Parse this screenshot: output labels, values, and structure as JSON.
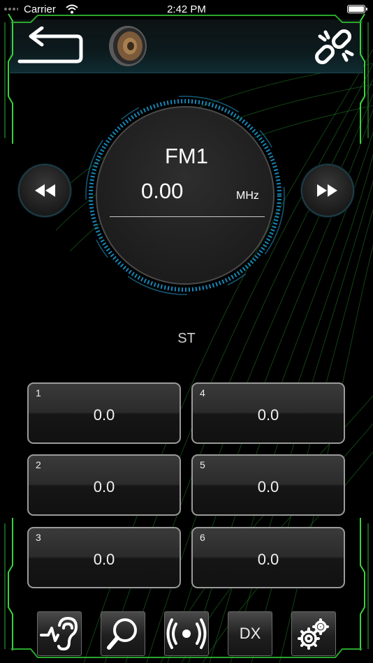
{
  "status_bar": {
    "carrier": "Carrier",
    "time": "2:42 PM"
  },
  "header": {
    "back_icon": "back-arrow-icon",
    "speaker_icon": "speaker-icon",
    "link_icon": "broken-link-icon"
  },
  "tuner": {
    "band": "FM1",
    "frequency": "0.00",
    "unit": "MHz",
    "stereo": "ST"
  },
  "presets": [
    {
      "num": "1",
      "value": "0.0"
    },
    {
      "num": "2",
      "value": "0.0"
    },
    {
      "num": "3",
      "value": "0.0"
    },
    {
      "num": "4",
      "value": "0.0"
    },
    {
      "num": "5",
      "value": "0.0"
    },
    {
      "num": "6",
      "value": "0.0"
    }
  ],
  "toolbar": {
    "dx_label": "DX"
  },
  "colors": {
    "accent_blue": "#1aa0d8",
    "frame_green": "#39d23a",
    "background": "#000000"
  }
}
